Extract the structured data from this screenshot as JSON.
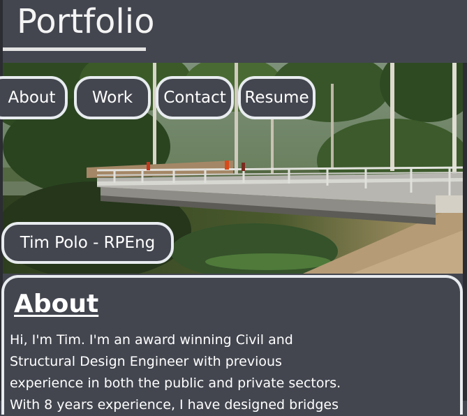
{
  "header": {
    "title": "Portfolio"
  },
  "nav": {
    "items": [
      {
        "label": "About"
      },
      {
        "label": "Work"
      },
      {
        "label": "Contact"
      },
      {
        "label": "Resume"
      }
    ]
  },
  "hero": {
    "image_alt": "bridge-photo",
    "name": "Tim Polo - RPEng"
  },
  "about": {
    "heading": "About",
    "body": "Hi, I'm Tim. I'm an award winning Civil and Structural Design Engineer with previous experience in both the public and private sectors. With 8 years experience, I have designed bridges"
  },
  "colors": {
    "background": "#43464f",
    "border": "#e8ecef",
    "text": "#ffffff"
  }
}
